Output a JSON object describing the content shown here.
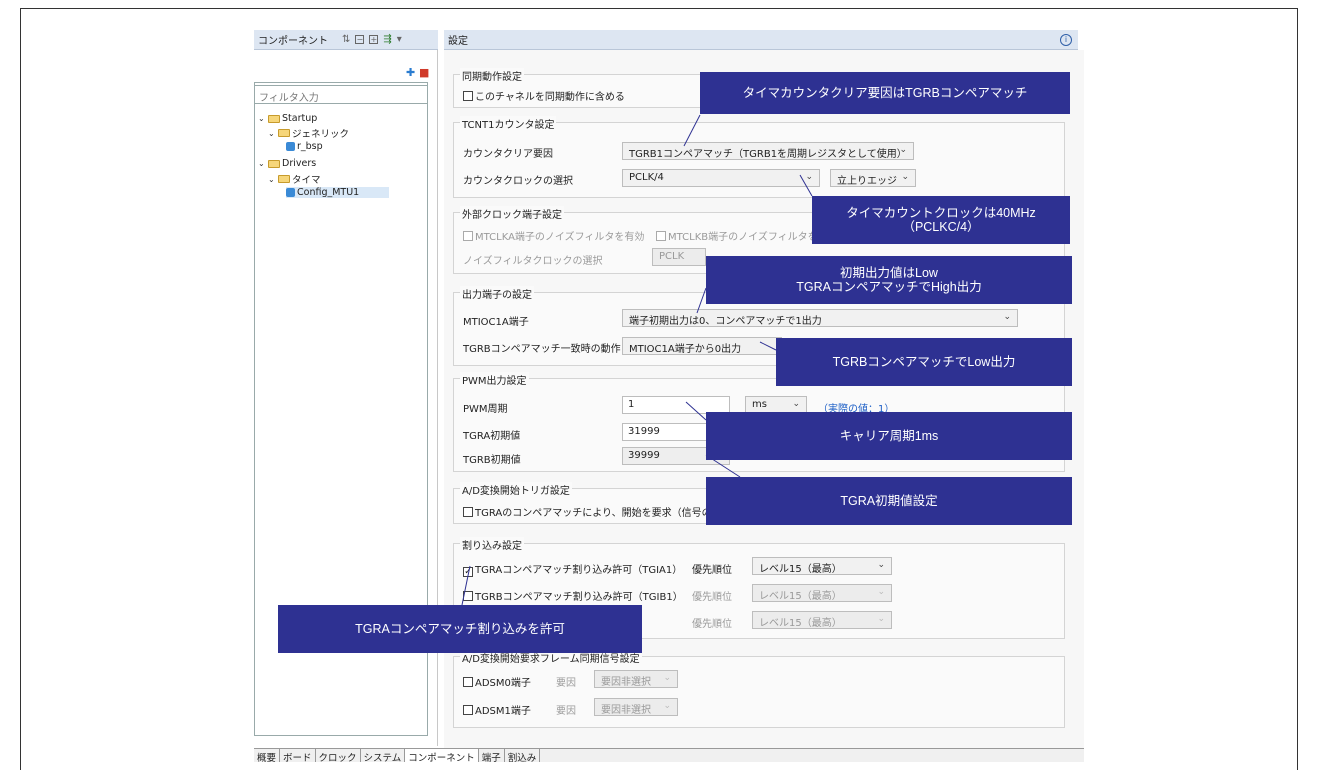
{
  "left_panel": {
    "title": "コンポーネント",
    "filter_placeholder": "フィルタ入力",
    "tree": [
      "Startup",
      "ジェネリック",
      "r_bsp",
      "Drivers",
      "タイマ",
      "Config_MTU1"
    ]
  },
  "bottom_tabs": [
    "概要",
    "ボード",
    "クロック",
    "システム",
    "コンポーネント",
    "端子",
    "割込み"
  ],
  "right_panel": {
    "title": "設定",
    "sync": {
      "title": "同期動作設定",
      "checkbox": "このチャネルを同期動作に含める"
    },
    "tcnt": {
      "title": "TCNT1カウンタ設定",
      "clear_label": "カウンタクリア要因",
      "clear_value": "TGRB1コンペアマッチ（TGRB1を周期レジスタとして使用）",
      "clock_label": "カウンタクロックの選択",
      "clock_value": "PCLK/4",
      "edge_value": "立上りエッジ"
    },
    "ext": {
      "title": "外部クロック端子設定",
      "cb_a": "MTCLKA端子のノイズフィルタを有効",
      "cb_b": "MTCLKB端子のノイズフィルタを有",
      "noise_label": "ノイズフィルタクロックの選択",
      "noise_value": "PCLK"
    },
    "out": {
      "title": "出力端子の設定",
      "pin_label": "MTIOC1A端子",
      "pin_value": "端子初期出力は0、コンペアマッチで1出力",
      "tgrb_label": "TGRBコンペアマッチ一致時の動作",
      "tgrb_value": "MTIOC1A端子から0出力"
    },
    "pwm": {
      "title": "PWM出力設定",
      "period_label": "PWM周期",
      "period_value": "1",
      "unit": "ms",
      "actual": "（実際の値：1）",
      "tgra_label": "TGRA初期値",
      "tgra_value": "31999",
      "tgrb_label": "TGRB初期値",
      "tgrb_value": "39999"
    },
    "ad": {
      "title": "A/D変換開始トリガ設定",
      "checkbox": "TGRAのコンペアマッチにより、開始を要求（信号のMT"
    },
    "irq": {
      "title": "割り込み設定",
      "row1": "TGRAコンペアマッチ割り込み許可（TGIA1）",
      "row2": "TGRBコンペアマッチ割り込み許可（TGIB1）",
      "prio": "優先順位",
      "level": "レベル15（最高）"
    },
    "adsm": {
      "title": "A/D変換開始要求フレーム同期信号設定",
      "row1": "ADSM0端子",
      "row2": "ADSM1端子",
      "cause": "要因",
      "cause_value": "要因非選択"
    }
  },
  "callouts": {
    "c1": "タイマカウンタクリア要因はTGRBコンペアマッチ",
    "c2a": "タイマカウントクロックは40MHz",
    "c2b": "（PCLKC/4）",
    "c3a": "初期出力値はLow",
    "c3b": "TGRAコンペアマッチでHigh出力",
    "c4": "TGRBコンペアマッチでLow出力",
    "c5": "キャリア周期1ms",
    "c6": "TGRA初期値設定",
    "c7": "TGRAコンペアマッチ割り込みを許可"
  }
}
